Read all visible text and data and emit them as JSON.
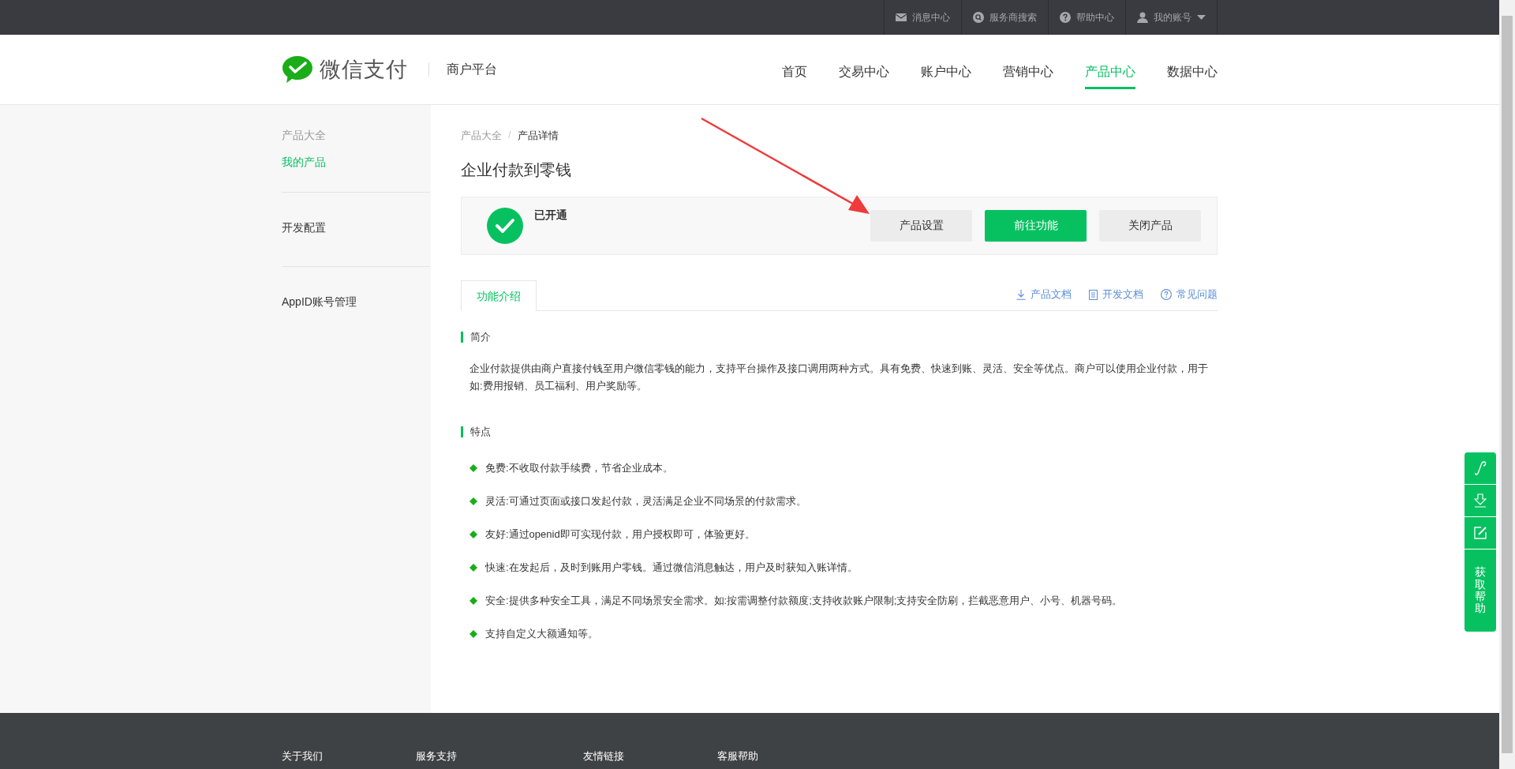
{
  "top_bar": {
    "items": [
      {
        "label": "消息中心",
        "kind": "mail"
      },
      {
        "label": "服务商搜索",
        "kind": "search"
      },
      {
        "label": "帮助中心",
        "kind": "help"
      },
      {
        "label": "我的账号",
        "kind": "account"
      }
    ]
  },
  "header": {
    "logo_text": "微信支付",
    "subtitle": "商户平台",
    "nav": [
      {
        "label": "首页",
        "selected": false
      },
      {
        "label": "交易中心",
        "selected": false
      },
      {
        "label": "账户中心",
        "selected": false
      },
      {
        "label": "营销中心",
        "selected": false
      },
      {
        "label": "产品中心",
        "selected": true
      },
      {
        "label": "数据中心",
        "selected": false
      }
    ]
  },
  "sidebar": {
    "groups": [
      {
        "items": [
          {
            "label": "产品大全",
            "selected": false
          },
          {
            "label": "我的产品",
            "selected": true
          }
        ]
      },
      {
        "items": [
          {
            "label": "开发配置",
            "selected": false
          }
        ]
      },
      {
        "items": [
          {
            "label": "AppID账号管理",
            "selected": false
          }
        ]
      }
    ]
  },
  "breadcrumb": {
    "items": [
      "产品大全",
      "产品详情"
    ],
    "separator": "/"
  },
  "title": "企业付款到零钱",
  "status": {
    "label": "已开通",
    "active": true
  },
  "buttons": [
    {
      "label": "产品设置",
      "kind": "default"
    },
    {
      "label": "前往功能",
      "kind": "primary"
    },
    {
      "label": "关闭产品",
      "kind": "default"
    }
  ],
  "tabs": [
    {
      "label": "功能介绍",
      "selected": true
    }
  ],
  "doc_links": [
    {
      "label": "产品文档",
      "kind": "download"
    },
    {
      "label": "开发文档",
      "kind": "doc"
    },
    {
      "label": "常见问题",
      "kind": "help"
    }
  ],
  "sections": [
    {
      "heading": "简介",
      "paragraph": "企业付款提供由商户直接付钱至用户微信零钱的能力，支持平台操作及接口调用两种方式。具有免费、快速到账、灵活、安全等优点。商户可以使用企业付款，用于如:费用报销、员工福利、用户奖励等。"
    },
    {
      "heading": "特点",
      "bullets": [
        "免费:不收取付款手续费，节省企业成本。",
        "灵活:可通过页面或接口发起付款，灵活满足企业不同场景的付款需求。",
        "友好:通过openid即可实现付款，用户授权即可，体验更好。",
        "快速:在发起后，及时到账用户零钱。通过微信消息触达，用户及时获知入账详情。",
        "安全:提供多种安全工具，满足不同场景安全需求。如:按需调整付款额度;支持收款账户限制;支持安全防刷，拦截恶意用户、小号、机器号码。",
        "支持自定义大额通知等。"
      ]
    }
  ],
  "float_panel": {
    "tools": [
      {
        "kind": "link"
      },
      {
        "kind": "download"
      },
      {
        "kind": "edit"
      }
    ],
    "help_label": "获取帮助"
  },
  "footer": {
    "columns": [
      "关于我们",
      "服务支持",
      "友情链接",
      "客服帮助"
    ]
  }
}
